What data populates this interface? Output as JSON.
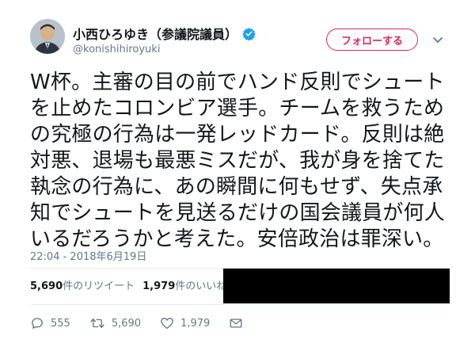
{
  "author": {
    "display_name": "小西ひろゆき（参議院議員）",
    "handle": "@konishihiroyuki",
    "verified": true
  },
  "follow_button": {
    "label": "フォローする"
  },
  "tweet": {
    "lines": [
      "W杯。主審の目の前でハンド反則でシュート",
      "を止めたコロンビア選手。チームを救うため",
      "の究極の行為は一発レッドカード。反則は絶",
      "対悪、退場も最悪ミスだが、我が身を捨てた",
      "執念の行為に、あの瞬間に何もせず、失点承",
      "知でシュートを見送るだけの国会議員が何人",
      "いるだろうかと考えた。安倍政治は罪深い。"
    ],
    "timestamp": "22:04 - 2018年6月19日"
  },
  "stats": {
    "retweets_count": "5,690",
    "retweets_label": "件のリツイート",
    "likes_count": "1,979",
    "likes_label": "件のいいね"
  },
  "actions": {
    "reply_count": "555",
    "retweet_count": "5,690",
    "like_count": "1,979"
  },
  "colors": {
    "accent": "#e0245e",
    "verified": "#1da1f2",
    "muted_text": "#657786"
  }
}
